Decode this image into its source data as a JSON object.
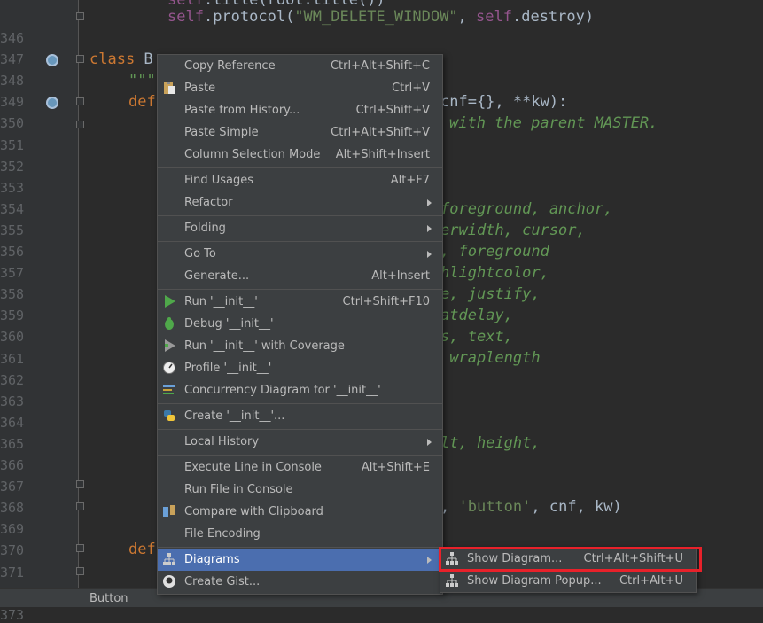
{
  "editor": {
    "line_numbers": [
      "346",
      "347",
      "348",
      "349",
      "350",
      "351",
      "352",
      "353",
      "354",
      "355",
      "356",
      "357",
      "358",
      "359",
      "360",
      "361",
      "362",
      "363",
      "364",
      "365",
      "366",
      "367",
      "368",
      "369",
      "370",
      "371",
      "372",
      "373"
    ],
    "line1": {
      "self1": "self",
      "rest1": ".title(root.title())"
    },
    "line2": {
      "self": "self",
      "mid": ".protocol(",
      "str": "\"WM_DELETE_WINDOW\"",
      "comma": ", ",
      "self2": "self",
      "end": ".destroy)"
    },
    "line348": {
      "kw": "class",
      "name": " B"
    },
    "line349": {
      "text": "\"\"\""
    },
    "line350": {
      "kw": "def",
      "tail": "cnf={}, **kw):"
    },
    "line351": {
      "tail": "with the parent MASTER."
    },
    "line355": {
      "tail": "foreground, anchor,"
    },
    "line356": {
      "tail": "erwidth, cursor,"
    },
    "line357": {
      "tail": ", foreground"
    },
    "line358": {
      "tail": "hlightcolor,"
    },
    "line359": {
      "tail": "e, justify,"
    },
    "line360": {
      "tail": "atdelay,"
    },
    "line361": {
      "tail": "s, text,"
    },
    "line362": {
      "tail": " wraplength"
    },
    "line366": {
      "tail": "lt, height,"
    },
    "line369": {
      "str": "'button'",
      "rest": ", cnf, kw)",
      "comma": ", "
    },
    "line371": {
      "kw": "def"
    }
  },
  "status_bar": {
    "breadcrumb": "Button"
  },
  "context_menu": {
    "items": [
      {
        "label": "Copy Reference",
        "shortcut": "Ctrl+Alt+Shift+C",
        "icon": ""
      },
      {
        "label": "Paste",
        "shortcut": "Ctrl+V",
        "icon": "clipboard-icon"
      },
      {
        "label": "Paste from History...",
        "shortcut": "Ctrl+Shift+V",
        "icon": ""
      },
      {
        "label": "Paste Simple",
        "shortcut": "Ctrl+Alt+Shift+V",
        "icon": ""
      },
      {
        "label": "Column Selection Mode",
        "shortcut": "Alt+Shift+Insert",
        "icon": ""
      },
      {
        "label": "Find Usages",
        "shortcut": "Alt+F7",
        "icon": ""
      },
      {
        "label": "Refactor",
        "shortcut": "",
        "icon": "",
        "submenu": true
      },
      {
        "label": "Folding",
        "shortcut": "",
        "icon": "",
        "submenu": true
      },
      {
        "label": "Go To",
        "shortcut": "",
        "icon": "",
        "submenu": true
      },
      {
        "label": "Generate...",
        "shortcut": "Alt+Insert",
        "icon": ""
      },
      {
        "label": "Run '__init__'",
        "shortcut": "Ctrl+Shift+F10",
        "icon": "run-icon"
      },
      {
        "label": "Debug '__init__'",
        "shortcut": "",
        "icon": "debug-icon"
      },
      {
        "label": "Run '__init__' with Coverage",
        "shortcut": "",
        "icon": "coverage-icon"
      },
      {
        "label": "Profile '__init__'",
        "shortcut": "",
        "icon": "profile-icon"
      },
      {
        "label": "Concurrency Diagram for '__init__'",
        "shortcut": "",
        "icon": "concurrency-icon"
      },
      {
        "label": "Create '__init__'...",
        "shortcut": "",
        "icon": "python-icon"
      },
      {
        "label": "Local History",
        "shortcut": "",
        "icon": "",
        "submenu": true
      },
      {
        "label": "Execute Line in Console",
        "shortcut": "Alt+Shift+E",
        "icon": ""
      },
      {
        "label": "Run File in Console",
        "shortcut": "",
        "icon": ""
      },
      {
        "label": "Compare with Clipboard",
        "shortcut": "",
        "icon": "compare-icon"
      },
      {
        "label": "File Encoding",
        "shortcut": "",
        "icon": ""
      },
      {
        "label": "Diagrams",
        "shortcut": "",
        "icon": "diagram-icon",
        "submenu": true,
        "selected": true
      },
      {
        "label": "Create Gist...",
        "shortcut": "",
        "icon": "github-icon"
      }
    ]
  },
  "submenu": {
    "items": [
      {
        "label": "Show Diagram...",
        "shortcut": "Ctrl+Alt+Shift+U",
        "icon": "diagram-icon"
      },
      {
        "label": "Show Diagram Popup...",
        "shortcut": "Ctrl+Alt+U",
        "icon": "diagram-icon"
      }
    ]
  },
  "colors": {
    "selection": "#4b6eaf",
    "menu_bg": "#3c3f41",
    "highlight_border": "#e8212a"
  }
}
